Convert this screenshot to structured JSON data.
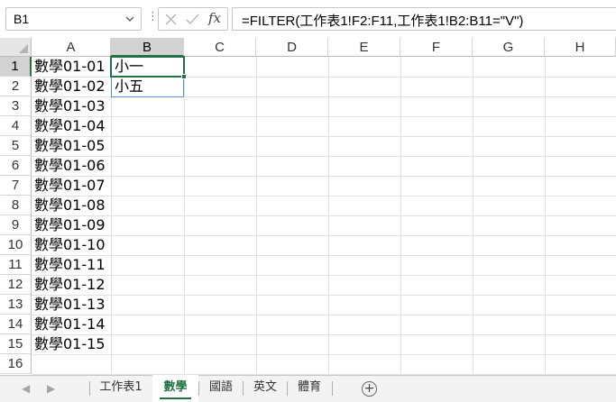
{
  "formula_bar": {
    "name_box": "B1",
    "more_indicator": "⋮",
    "fx_label": "fx",
    "formula": "=FILTER(工作表1!F2:F11,工作表1!B2:B11=\"V\")"
  },
  "columns": [
    "A",
    "B",
    "C",
    "D",
    "E",
    "F",
    "G",
    "H"
  ],
  "active_column": "B",
  "rows": [
    "1",
    "2",
    "3",
    "4",
    "5",
    "6",
    "7",
    "8",
    "9",
    "10",
    "11",
    "12",
    "13",
    "14",
    "15",
    "16"
  ],
  "active_row": "1",
  "column_a": [
    "數學01-01",
    "數學01-02",
    "數學01-03",
    "數學01-04",
    "數學01-05",
    "數學01-06",
    "數學01-07",
    "數學01-08",
    "數學01-09",
    "數學01-10",
    "數學01-11",
    "數學01-12",
    "數學01-13",
    "數學01-14",
    "數學01-15"
  ],
  "column_b": [
    "小一",
    "小五"
  ],
  "sheet_tabs": {
    "tabs": [
      "工作表1",
      "數學",
      "國語",
      "英文",
      "體育"
    ],
    "active": "數學",
    "add_symbol": "+"
  },
  "colors": {
    "accent": "#217346",
    "spill_border": "#5b8fd6"
  }
}
